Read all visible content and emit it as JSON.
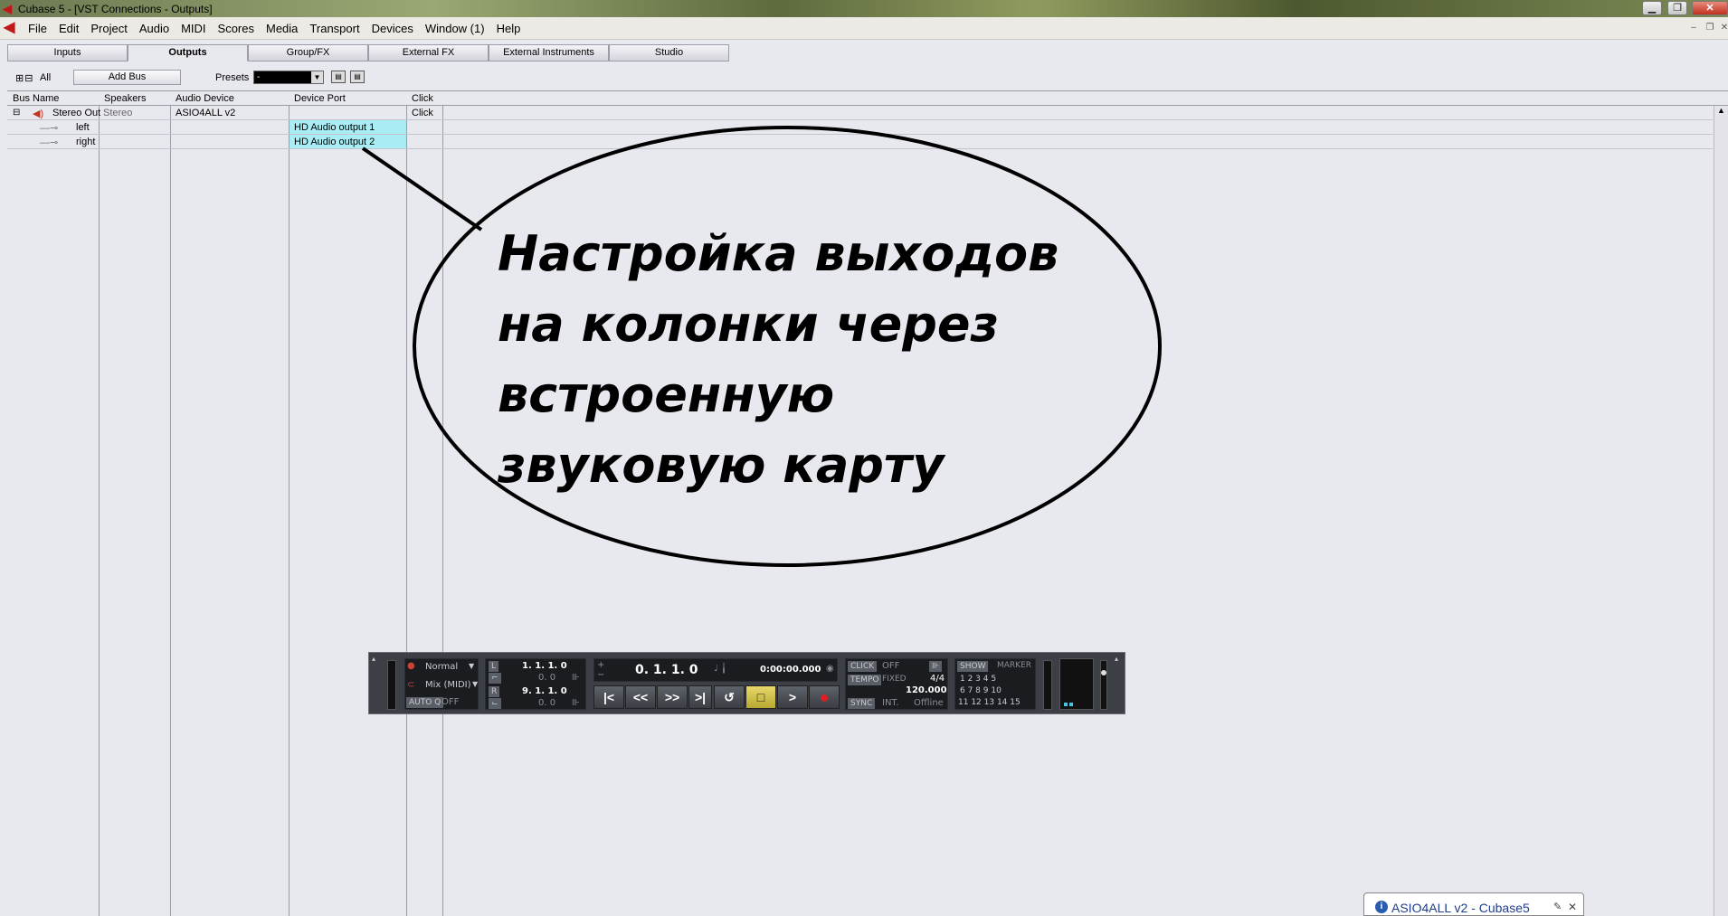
{
  "window": {
    "title": "Cubase 5 - [VST Connections - Outputs]",
    "logo_icon": "cubase-logo-icon"
  },
  "menu": [
    "File",
    "Edit",
    "Project",
    "Audio",
    "MIDI",
    "Scores",
    "Media",
    "Transport",
    "Devices",
    "Window (1)",
    "Help"
  ],
  "tabs": [
    "Inputs",
    "Outputs",
    "Group/FX",
    "External FX",
    "External Instruments",
    "Studio"
  ],
  "active_tab": "Outputs",
  "toolbar": {
    "all_label": "All",
    "add_bus_label": "Add Bus",
    "presets_label": "Presets",
    "presets_value": "-"
  },
  "columns": [
    "Bus Name",
    "Speakers",
    "Audio Device",
    "Device Port",
    "Click"
  ],
  "rows": [
    {
      "bus_name": "Stereo Out",
      "speakers": "Stereo",
      "audio_device": "ASIO4ALL v2",
      "device_port": "",
      "click": "Click"
    },
    {
      "bus_name": "left",
      "speakers": "",
      "audio_device": "",
      "device_port": "HD Audio output 1",
      "click": ""
    },
    {
      "bus_name": "right",
      "speakers": "",
      "audio_device": "",
      "device_port": "HD Audio output 2",
      "click": ""
    }
  ],
  "callout": {
    "text": "Настройка выходов на колонки через встроенную звуковую карту"
  },
  "transport": {
    "mode": "Normal",
    "mix": "Mix (MIDI)",
    "autoq_label": "AUTO Q",
    "autoq_value": "OFF",
    "left_locator": "1. 1. 1.   0",
    "right_locator": "9. 1. 1.   0",
    "small_val_1": "0.    0",
    "small_val_2": "0.    0",
    "position_bars": "0. 1. 1.   0",
    "position_time": "0:00:00.000",
    "click_label": "CLICK",
    "click_value": "OFF",
    "tempo_label": "TEMPO",
    "tempo_mode": "FIXED",
    "signature": "4/4",
    "tempo": "120.000",
    "sync_label": "SYNC",
    "sync_value": "INT.",
    "sync_status": "Offline",
    "show_label": "SHOW",
    "marker_label": "MARKER",
    "marker_row1": "1   2   3   4   5",
    "marker_row2": "6   7   8   9  10",
    "marker_row3": "11  12  13  14  15"
  },
  "notification": {
    "text": "ASIO4ALL v2 - Cubase5"
  }
}
